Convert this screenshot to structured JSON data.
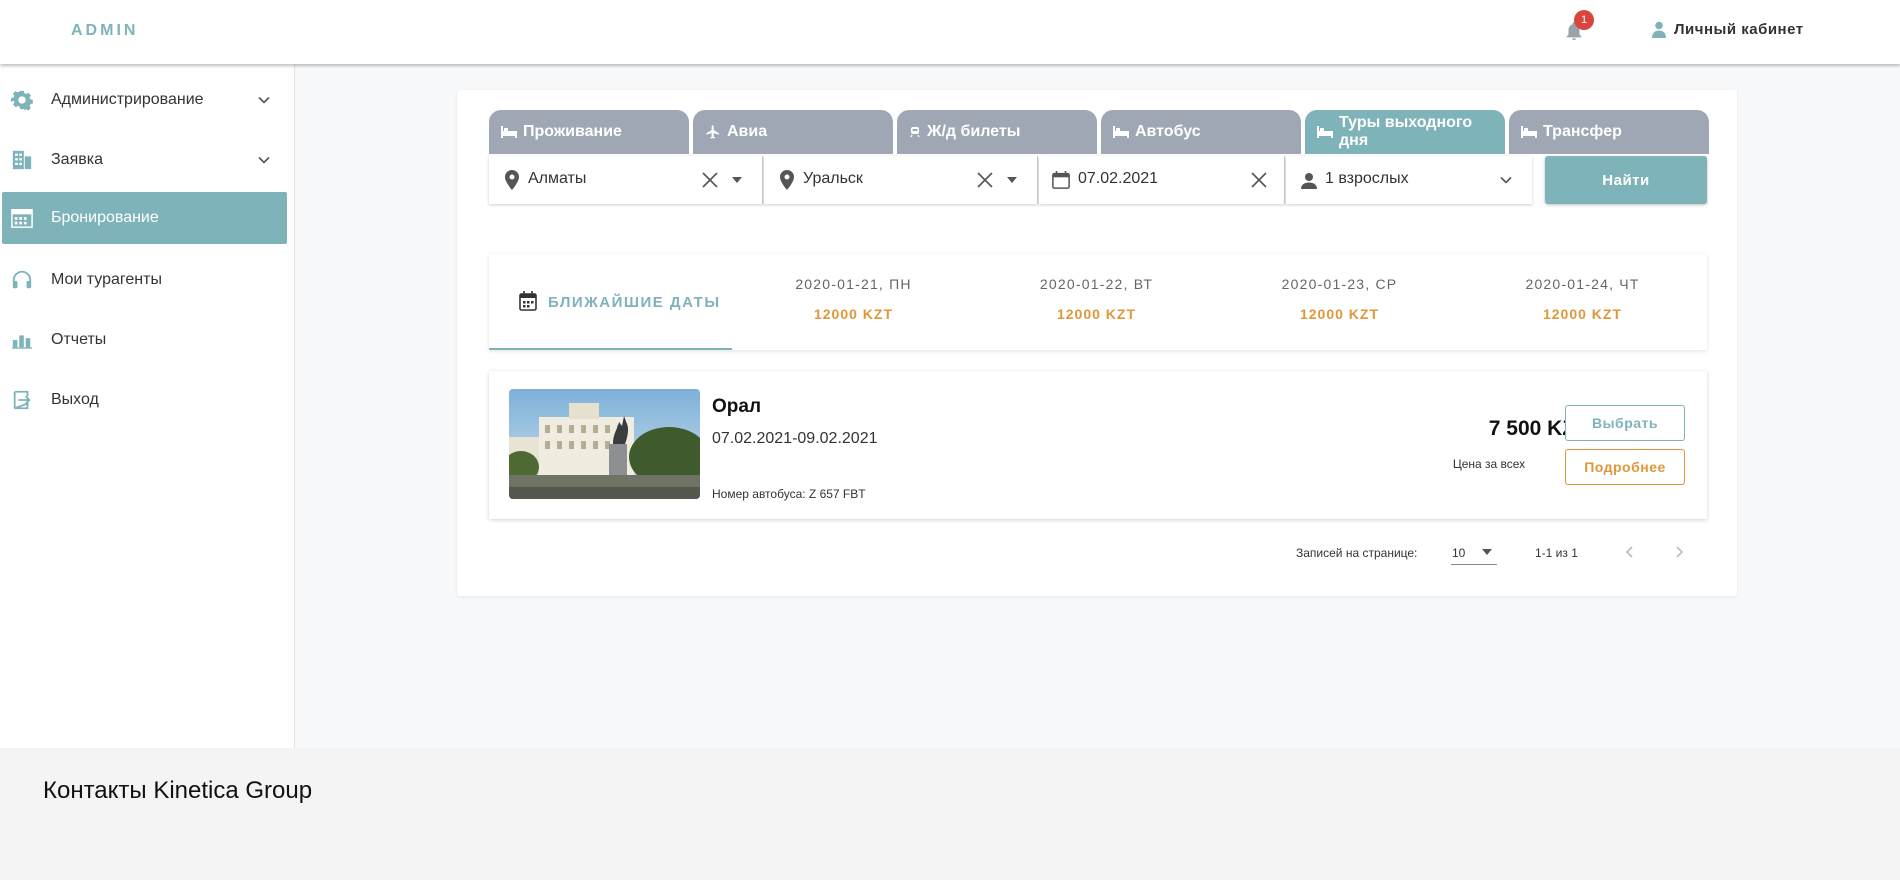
{
  "header": {
    "brand": "ADMIN",
    "notifications_count": "1",
    "cabinet_label": "Личный кабинет"
  },
  "sidebar": {
    "items": [
      {
        "label": "Администрирование",
        "icon": "gear-cog-icon",
        "expandable": true
      },
      {
        "label": "Заявка",
        "icon": "building-icon",
        "expandable": true
      },
      {
        "label": "Бронирование",
        "icon": "calendar-grid-icon",
        "active": true
      },
      {
        "label": "Мои турагенты",
        "icon": "headset-icon"
      },
      {
        "label": "Отчеты",
        "icon": "bar-chart-icon"
      },
      {
        "label": "Выход",
        "icon": "logout-icon"
      }
    ]
  },
  "tabs": [
    {
      "label": "Проживание",
      "icon": "bed-icon"
    },
    {
      "label": "Авиа",
      "icon": "airplane-icon"
    },
    {
      "label": "Ж/д билеты",
      "icon": "train-icon"
    },
    {
      "label": "Автобус",
      "icon": "bed-icon"
    },
    {
      "label": "Туры выходного дня",
      "icon": "bed-icon",
      "active": true
    },
    {
      "label": "Трансфер",
      "icon": "bed-icon"
    }
  ],
  "search": {
    "from": "Алматы",
    "to": "Уральск",
    "date": "07.02.2021",
    "passengers": "1 взрослых",
    "find_label": "Найти"
  },
  "dates": {
    "nearest_label": "БЛИЖАЙШИЕ ДАТЫ",
    "items": [
      {
        "date": "2020-01-21, ПН",
        "price": "12000 KZT"
      },
      {
        "date": "2020-01-22, ВТ",
        "price": "12000 KZT"
      },
      {
        "date": "2020-01-23, СР",
        "price": "12000 KZT"
      },
      {
        "date": "2020-01-24, ЧТ",
        "price": "12000 KZT"
      }
    ]
  },
  "result": {
    "name": "Орал",
    "dates": "07.02.2021-09.02.2021",
    "bus_number": "Номер автобуса: Z 657 FBT",
    "price": "7 500 KZT",
    "price_note": "Цена за всех",
    "select_label": "Выбрать",
    "more_label": "Подробнее"
  },
  "pagination": {
    "per_page_label": "Записей на странице:",
    "per_page_value": "10",
    "range": "1-1 из 1"
  },
  "footer": {
    "title": "Контакты Kinetica Group"
  },
  "colors": {
    "accent": "#7fb3ba",
    "tab_inactive": "#a0a7b4",
    "price_orange": "#e0973a",
    "badge_red": "#d9443b"
  }
}
